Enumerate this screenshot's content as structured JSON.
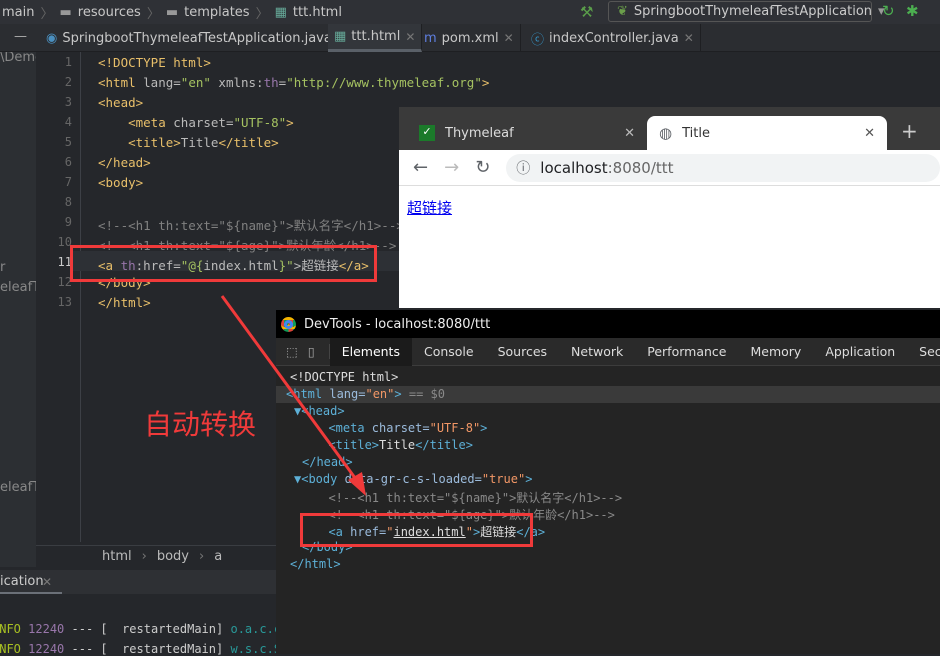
{
  "breadcrumb": [
    "main",
    "resources",
    "templates",
    "ttt.html"
  ],
  "run_config": "SpringbootThymeleafTestApplication",
  "editor_tabs": [
    {
      "label": "SpringbootThymeleafTestApplication.java",
      "icon": "spring-class-icon"
    },
    {
      "label": "ttt.html",
      "icon": "html-file-icon",
      "active": true
    },
    {
      "label": "pom.xml",
      "icon": "maven-icon"
    },
    {
      "label": "indexController.java",
      "icon": "class-icon"
    }
  ],
  "project_fragments": [
    "\\Demo",
    "r",
    "eleafTe",
    "eleafTe"
  ],
  "code_lines": [
    {
      "n": "1",
      "parts": [
        [
          "tag",
          "<!DOCTYPE html>"
        ]
      ]
    },
    {
      "n": "2",
      "parts": [
        [
          "tag",
          "<html "
        ],
        [
          "attr",
          "lang="
        ],
        [
          "str",
          "\"en\""
        ],
        [
          "attr",
          " xmlns:"
        ],
        [
          "th",
          "th"
        ],
        [
          "attr",
          "="
        ],
        [
          "str",
          "\"http://www.thymeleaf.org\""
        ],
        [
          "tag",
          ">"
        ]
      ]
    },
    {
      "n": "3",
      "parts": [
        [
          "tag",
          "<head>"
        ]
      ]
    },
    {
      "n": "4",
      "parts": [
        [
          "tag",
          "    <meta "
        ],
        [
          "attr",
          "charset="
        ],
        [
          "str",
          "\"UTF-8\""
        ],
        [
          "tag",
          ">"
        ]
      ]
    },
    {
      "n": "5",
      "parts": [
        [
          "tag",
          "    <title>"
        ],
        [
          "attr",
          "Title"
        ],
        [
          "tag",
          "</title>"
        ]
      ]
    },
    {
      "n": "6",
      "parts": [
        [
          "tag",
          "</head>"
        ]
      ]
    },
    {
      "n": "7",
      "parts": [
        [
          "tag",
          "<body>"
        ]
      ]
    },
    {
      "n": "8",
      "parts": []
    },
    {
      "n": "9",
      "parts": [
        [
          "cm",
          "<!--<h1 th:text=\"${name}\">默认名字</h1>-->"
        ]
      ]
    },
    {
      "n": "10",
      "parts": [
        [
          "cm",
          "<!--<h1 th:text=\"${age}\">默认年龄</h1>-->"
        ]
      ]
    },
    {
      "n": "11",
      "parts": [
        [
          "tag",
          "<a "
        ],
        [
          "th",
          "th"
        ],
        [
          "attr",
          ":href="
        ],
        [
          "str",
          "\"@{"
        ],
        [
          "attr",
          "index.html"
        ],
        [
          "str",
          "}\""
        ],
        [
          "attr",
          ">超链接"
        ],
        [
          "tag",
          "</a>"
        ]
      ]
    },
    {
      "n": "12",
      "parts": [
        [
          "tag",
          "</body>"
        ]
      ]
    },
    {
      "n": "13",
      "parts": [
        [
          "tag",
          "</html>"
        ]
      ]
    }
  ],
  "editor_breadcrumb": [
    "html",
    "body",
    "a"
  ],
  "run_tab": "ication",
  "log_lines": [
    {
      "level": "INFO",
      "pid": "12240",
      "sep": "--- [",
      "thread": "restartedMain]",
      "cls": "o.a.c.c"
    },
    {
      "level": "INFO",
      "pid": "12240",
      "sep": "--- [",
      "thread": "restartedMain]",
      "cls": "w.s.c.S"
    }
  ],
  "browser": {
    "tabs": [
      {
        "label": "Thymeleaf"
      },
      {
        "label": "Title",
        "active": true
      }
    ],
    "url_host": "localhost",
    "url_rest": ":8080/ttt",
    "page_link": "超链接"
  },
  "devtools": {
    "title": "DevTools - localhost:8080/ttt",
    "tabs": [
      "Elements",
      "Console",
      "Sources",
      "Network",
      "Performance",
      "Memory",
      "Application",
      "Security"
    ],
    "lines": [
      [
        [
          "",
          "<!DOCTYPE html>"
        ]
      ],
      [
        [
          "dt",
          "<html "
        ],
        [
          "da",
          "lang="
        ],
        [
          "dv",
          "\"en\""
        ],
        [
          "dt",
          ">"
        ],
        [
          "dc",
          " == $0"
        ]
      ],
      [
        [
          "dt",
          "▼<head>"
        ]
      ],
      [
        [
          "dt",
          "  <meta "
        ],
        [
          "da",
          "charset="
        ],
        [
          "dv",
          "\"UTF-8\""
        ],
        [
          "dt",
          ">"
        ]
      ],
      [
        [
          "dt",
          "  <title>"
        ],
        [
          "",
          "Title"
        ],
        [
          "dt",
          "</title>"
        ]
      ],
      [
        [
          "dt",
          "</head>"
        ]
      ],
      [
        [
          "dt",
          "▼<body "
        ],
        [
          "da",
          "data-gr-c-s-loaded="
        ],
        [
          "dv",
          "\"true\""
        ],
        [
          "dt",
          ">"
        ]
      ],
      [
        [
          "dc",
          "  <!--<h1 th:text=\"${name}\">默认名字</h1>-->"
        ]
      ],
      [
        [
          "dc",
          "  <!--<h1 th:text=\"${age}\">默认年龄</h1>-->"
        ]
      ],
      [
        [
          "dt",
          "  <a "
        ],
        [
          "da",
          "href="
        ],
        [
          "dv",
          "\""
        ],
        [
          "",
          "index.html"
        ],
        [
          "dv",
          "\""
        ],
        [
          "dt",
          ">"
        ],
        [
          "",
          "超链接"
        ],
        [
          "dt",
          "</a>"
        ]
      ],
      [
        [
          "dt",
          "</body>"
        ]
      ],
      [
        [
          "dt",
          "</html>"
        ]
      ]
    ]
  },
  "annotation": "自动转换",
  "colors": {
    "annotation": "#f03a3a",
    "link": "#0000ee"
  }
}
